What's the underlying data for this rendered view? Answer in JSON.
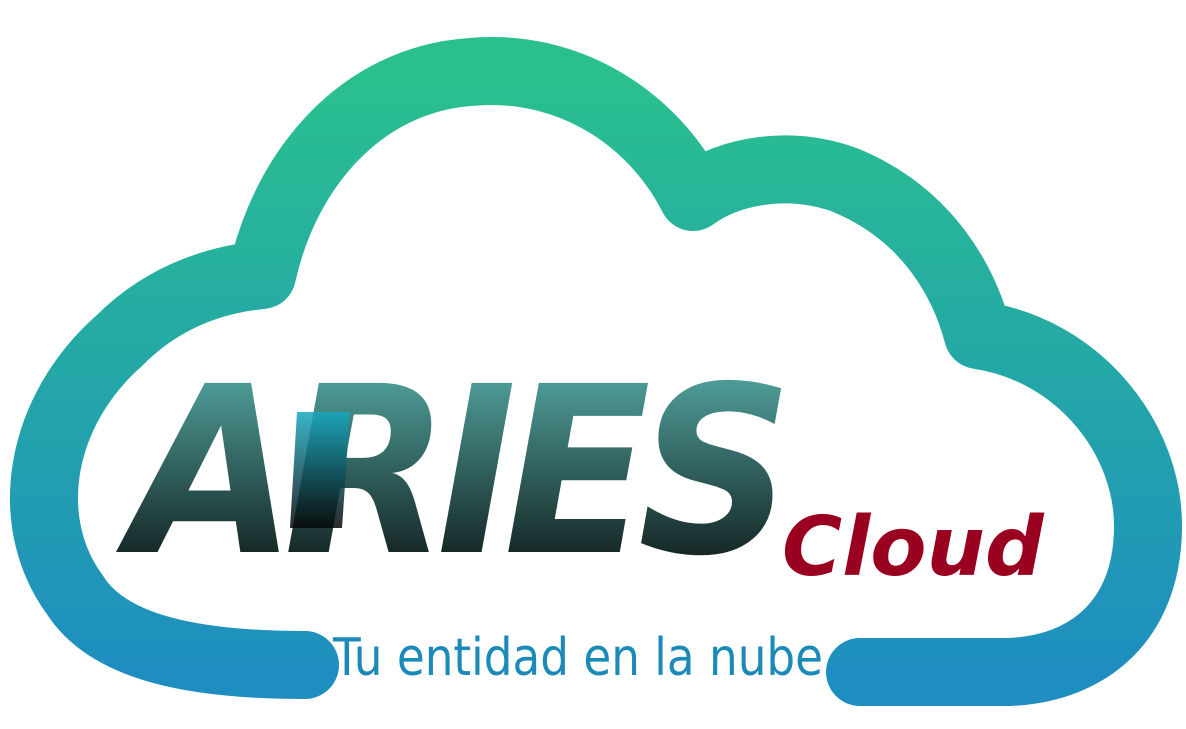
{
  "logo": {
    "brand_name": "ARIES",
    "product": "Cloud",
    "tagline": "Tu entidad en la nube",
    "colors": {
      "cloud_top": "#2ac08e",
      "cloud_bottom": "#1e8ec0",
      "brand_top": "#5bb8b2",
      "brand_bottom": "#050505",
      "accent_i": "#18a8c0",
      "product": "#9a0020",
      "tagline": "#1b8ab8"
    },
    "icons": [
      "cloud-outline-icon"
    ]
  }
}
